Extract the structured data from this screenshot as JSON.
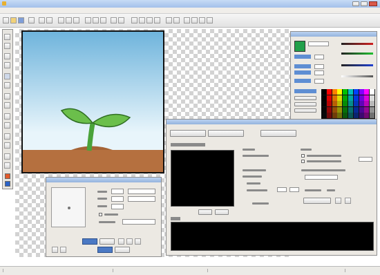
{
  "window": {
    "title": "",
    "accent_color": "#a9c4ec"
  },
  "menubar": {
    "items": [
      "",
      "",
      "",
      "",
      "",
      "",
      "",
      "",
      "",
      "",
      ""
    ]
  },
  "canvas": {
    "sky_top": "#6fb4dc",
    "sky_bottom": "#e8f5fb",
    "ground": "#b5703f",
    "leaf": "#6bbf4b",
    "stem": "#4aa33a"
  },
  "color_panel": {
    "title": "",
    "current_color": "#22a04a",
    "labels": [
      "",
      "",
      "",
      ""
    ],
    "palette_header": ""
  },
  "layer_panel": {
    "title": "",
    "fields": [
      "",
      "",
      ""
    ],
    "buttons": [
      "",
      ""
    ]
  },
  "animation_panel": {
    "title": "",
    "top_buttons": [
      "",
      "",
      ""
    ],
    "preview_label": "",
    "preview_buttons": [
      "",
      ""
    ],
    "col1_texts": [
      "",
      "",
      "",
      "",
      "",
      ""
    ],
    "col2_texts": [
      "",
      "",
      "",
      "",
      "",
      ""
    ],
    "log_label": ""
  },
  "statusbar": {
    "left": "",
    "right": ""
  }
}
